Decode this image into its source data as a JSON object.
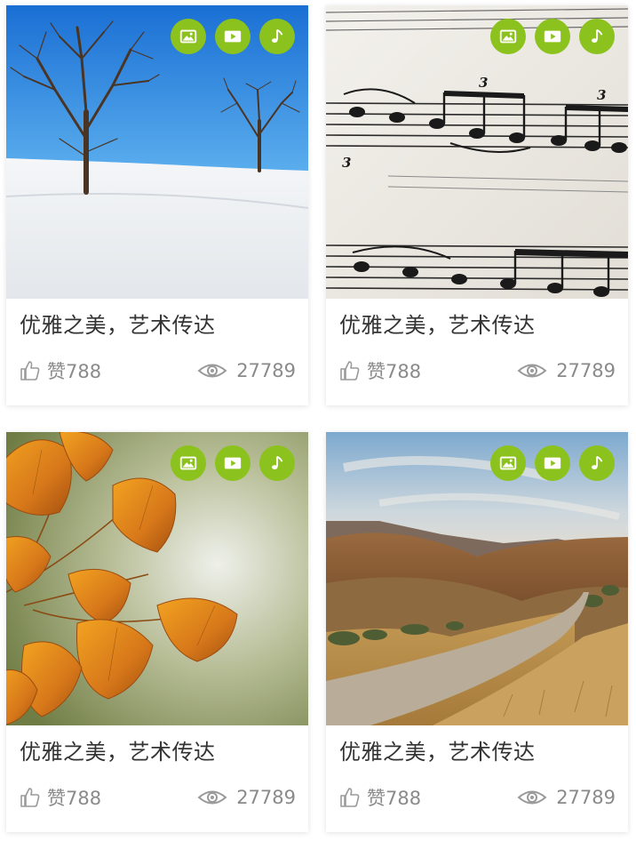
{
  "colors": {
    "accent_green": "#8cc21d",
    "title_text": "#333333",
    "meta_text": "#8a8a8a"
  },
  "cards": [
    {
      "image": "winter-trees-snow",
      "title": "优雅之美，艺术传达",
      "likes": "赞788",
      "views": "27789",
      "media_icons": [
        "image-icon",
        "video-icon",
        "music-note-icon"
      ]
    },
    {
      "image": "sheet-music",
      "title": "优雅之美，艺术传达",
      "likes": "赞788",
      "views": "27789",
      "media_icons": [
        "image-icon",
        "video-icon",
        "music-note-icon"
      ]
    },
    {
      "image": "ginkgo-leaves",
      "title": "优雅之美，艺术传达",
      "likes": "赞788",
      "views": "27789",
      "media_icons": [
        "image-icon",
        "video-icon",
        "music-note-icon"
      ]
    },
    {
      "image": "dirt-road-hills",
      "title": "优雅之美，艺术传达",
      "likes": "赞788",
      "views": "27789",
      "media_icons": [
        "image-icon",
        "video-icon",
        "music-note-icon"
      ]
    }
  ]
}
